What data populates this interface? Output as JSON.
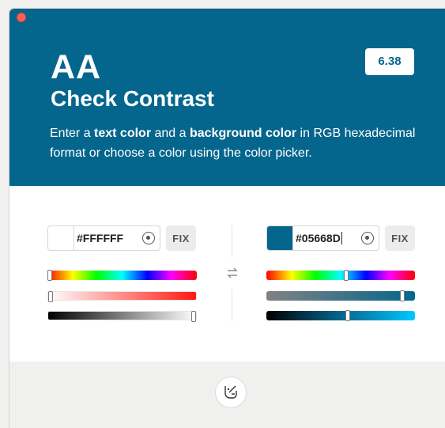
{
  "header": {
    "rating": "AA",
    "title": "Check Contrast",
    "description": {
      "part1": "Enter a ",
      "bold1": "text color",
      "part2": " and a ",
      "bold2": "background color",
      "part3": " in RGB hexadecimal format or choose a color using the color picker."
    },
    "ratio": "6.38",
    "background_color": "#05668D"
  },
  "text_color": {
    "hex": "#FFFFFF",
    "swatch_color": "#FFFFFF",
    "picker_icon": "eyedropper-target-icon",
    "fix_label": "FIX",
    "sliders": {
      "hue": 0.0,
      "saturation": 0.0,
      "lightness": 1.0
    }
  },
  "background_color": {
    "hex": "#05668D",
    "swatch_color": "#05668D",
    "picker_icon": "eyedropper-target-icon",
    "fix_label": "FIX",
    "sliders": {
      "hue": 0.54,
      "saturation": 0.93,
      "lightness": 0.55
    }
  },
  "icons": {
    "swap": "swap-arrows-icon",
    "footer_button": "palette-hand-icon"
  },
  "colors": {
    "accent": "#05668D",
    "close": "#FE5F57"
  }
}
